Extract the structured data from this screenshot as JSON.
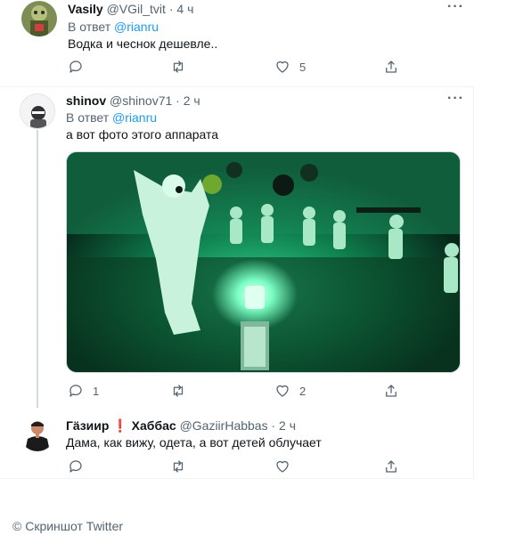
{
  "tweets": [
    {
      "name": "Vasily",
      "handle": "@VGil_tvit",
      "dot": "·",
      "time": "4 ч",
      "reply_prefix": "В ответ",
      "reply_to": "@rianru",
      "text": "Водка и чеснок дешевле..",
      "replies": "",
      "retweets": "",
      "likes": "5"
    },
    {
      "name": "shinov",
      "handle": "@shinov71",
      "dot": "·",
      "time": "2 ч",
      "reply_prefix": "В ответ",
      "reply_to": "@rianru",
      "text": "а вот фото этого аппарата",
      "replies": "1",
      "retweets": "",
      "likes": "2"
    },
    {
      "name": "Гäзиир",
      "flag": "❗",
      "name_rest": "Хаббас",
      "handle": "@GaziirHabbas",
      "dot": "·",
      "time": "2 ч",
      "text": "Дама, как вижу, одета, а вот детей облучает",
      "replies": "",
      "retweets": "",
      "likes": ""
    }
  ],
  "icons": {
    "reply": "reply-icon",
    "retweet": "retweet-icon",
    "like": "heart-icon",
    "share": "share-icon",
    "more": "more-icon"
  },
  "colors": {
    "link": "#1d9bf0",
    "secondary": "#536471",
    "alert_flag": "#f4212e"
  },
  "caption": "© Скриншот Twitter"
}
